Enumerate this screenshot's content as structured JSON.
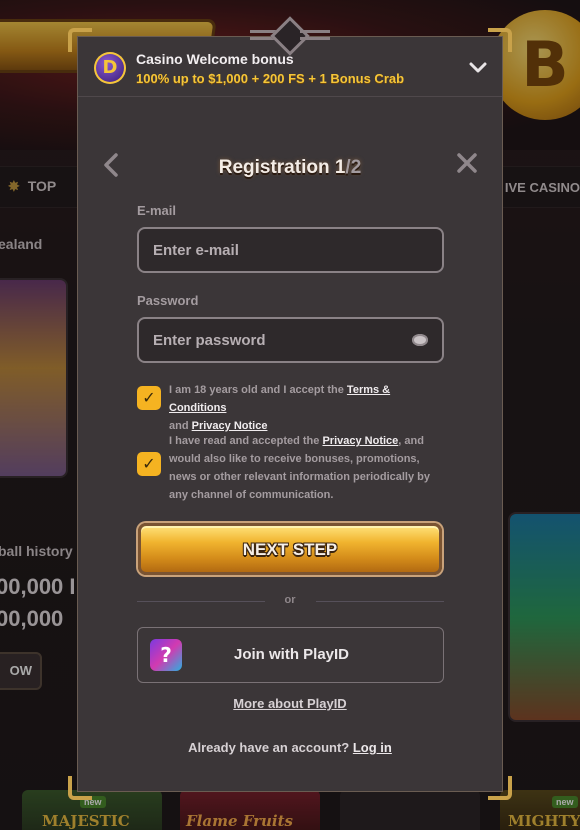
{
  "background": {
    "nav_top_label": "TOP",
    "nav_live_label": "IVE CASINO",
    "region_text": "ealand",
    "history_text": "ball history",
    "amount_1": "00,000 I",
    "amount_2": "00,000",
    "view_button": "OW",
    "coin_symbol": "B",
    "bottom_games": [
      {
        "badge": "new",
        "title": "MAJESTIC"
      },
      {
        "badge": "",
        "title": "Flame Fruits"
      },
      {
        "badge": "new",
        "title": "MIGHTY"
      }
    ]
  },
  "bonus": {
    "title": "Casino Welcome bonus",
    "subtitle": "100% up to $1,000 + 200 FS + 1 Bonus Crab",
    "logo_letter": "D",
    "chevron_icon": "chevron-down-icon"
  },
  "registration": {
    "title_prefix": "Registration 1",
    "title_total": "/2",
    "back_icon": "‹",
    "close_icon": "✕",
    "email": {
      "label": "E-mail",
      "placeholder": "Enter e-mail",
      "value": ""
    },
    "password": {
      "label": "Password",
      "placeholder": "Enter password",
      "value": ""
    },
    "consent_age": {
      "text_before": "I am 18 years old and I accept the ",
      "link_terms": "Terms & Conditions",
      "text_and": " and ",
      "link_privacy": "Privacy Notice",
      "checked": true
    },
    "consent_marketing": {
      "text_before": "I have read and accepted the ",
      "link_privacy": "Privacy Notice",
      "text_after": ", and would also like to receive bonuses, promotions, news or other relevant information periodically by any channel of communication.",
      "checked": true
    },
    "next_button": "NEXT STEP",
    "or_text": "or",
    "playid_button": "Join with PlayID",
    "more_playid": "More about PlayID",
    "have_account": "Already have an account? ",
    "login_link": "Log in"
  },
  "colors": {
    "accent_gold": "#f5b321",
    "modal_bg": "#3b3638",
    "frame_gold": "#c9a24a"
  }
}
